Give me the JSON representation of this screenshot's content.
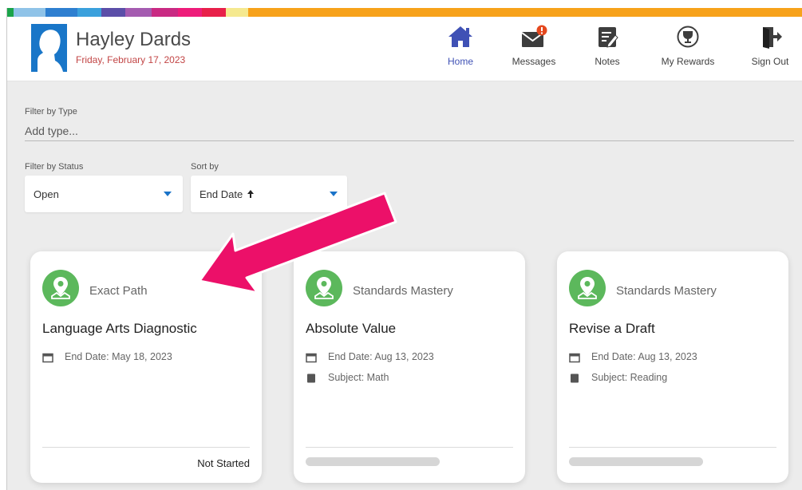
{
  "colors": {
    "stripe": [
      "#1aa44a",
      "#8fc3e8",
      "#2e7fd0",
      "#3aa0dc",
      "#5b4ea8",
      "#a45bb0",
      "#c92a83",
      "#ee1c7a",
      "#e8204a",
      "#f5e98f",
      "#f7a21b"
    ],
    "accent": "#3f51b5",
    "badge": "#5cb85c",
    "annotation_arrow": "#ec1069"
  },
  "user": {
    "name": "Hayley Dards",
    "date": "Friday, February 17, 2023"
  },
  "nav": [
    {
      "label": "Home",
      "icon": "home-icon"
    },
    {
      "label": "Messages",
      "icon": "envelope-icon"
    },
    {
      "label": "Notes",
      "icon": "notes-icon"
    },
    {
      "label": "My Rewards",
      "icon": "trophy-icon"
    },
    {
      "label": "Sign Out",
      "icon": "exit-door-icon"
    }
  ],
  "filters": {
    "type_label": "Filter by Type",
    "type_placeholder": "Add type...",
    "status_label": "Filter by Status",
    "status_value": "Open",
    "sort_label": "Sort by",
    "sort_value": "End Date"
  },
  "cards": [
    {
      "type": "Exact Path",
      "title": "Language Arts Diagnostic",
      "end_date": "End Date: May 18, 2023",
      "status": "Not Started"
    },
    {
      "type": "Standards Mastery",
      "title": "Absolute Value",
      "end_date": "End Date: Aug 13, 2023",
      "subject": "Subject: Math"
    },
    {
      "type": "Standards Mastery",
      "title": "Revise a Draft",
      "end_date": "End Date: Aug 13, 2023",
      "subject": "Subject: Reading"
    }
  ]
}
